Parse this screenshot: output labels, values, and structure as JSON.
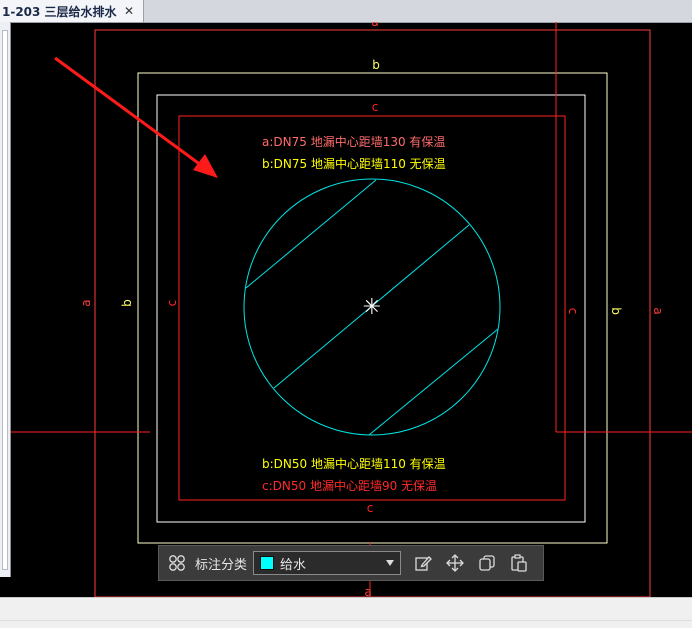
{
  "tab": {
    "title": "1-203 三层给水排水",
    "close_glyph": "✕"
  },
  "drawing": {
    "top_letters": [
      "a",
      "b",
      "c"
    ],
    "left_letters": [
      "a",
      "b",
      "c"
    ],
    "right_letters": [
      "c",
      "b",
      "a"
    ],
    "bottom_letters": [
      "c",
      "a"
    ],
    "center_mark": "✳",
    "top_notes": [
      {
        "text": "a:DN75 地漏中心距墙130  有保温",
        "color": "#ff6b6b"
      },
      {
        "text": "b:DN75 地漏中心距墙110  无保温",
        "color": "#ffff00"
      }
    ],
    "bottom_notes": [
      {
        "text": "b:DN50 地漏中心距墙110  有保温",
        "color": "#ffff00"
      },
      {
        "text": "c:DN50 地漏中心距墙90  无保温",
        "color": "#ff2a2a"
      }
    ],
    "colors": {
      "a": "#ff3b3b",
      "b": "#ffffcc",
      "c": "#ff2222",
      "pipe": "#00e5e5",
      "arrow": "#ff1a1a"
    }
  },
  "toolbar": {
    "grid_icon": "grid-icon",
    "label": "标注分类",
    "select_value": "给水",
    "select_color": "#00ffff",
    "icons": [
      "edit-icon",
      "move-icon",
      "copy-icon",
      "paste-icon"
    ]
  }
}
